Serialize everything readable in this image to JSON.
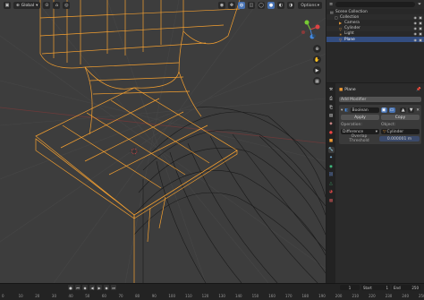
{
  "viewport": {
    "transform_mode": "Global",
    "options_label": "Options"
  },
  "outliner": {
    "items": [
      {
        "label": "Scene Collection",
        "indent": 0,
        "icon": "scene-collection-icon",
        "color": "#bbbbbb"
      },
      {
        "label": "Collection",
        "indent": 1,
        "icon": "collection-icon",
        "color": "#bbbbbb"
      },
      {
        "label": "Camera",
        "indent": 2,
        "icon": "camera-icon",
        "color": "#e59a3a"
      },
      {
        "label": "Cylinder",
        "indent": 2,
        "icon": "mesh-icon",
        "color": "#e59a3a"
      },
      {
        "label": "Light",
        "indent": 2,
        "icon": "light-icon",
        "color": "#e59a3a"
      },
      {
        "label": "Plane",
        "indent": 2,
        "icon": "mesh-icon",
        "color": "#e59a3a",
        "selected": true
      }
    ]
  },
  "properties": {
    "object_name": "Plane",
    "add_modifier_label": "Add Modifier",
    "modifier": {
      "name": "Boolean",
      "apply_label": "Apply",
      "copy_label": "Copy",
      "operation_label": "Operation:",
      "operation_value": "Difference",
      "object_label": "Object:",
      "object_value": "Cylinder",
      "overlap_label": "Overlap Threshold",
      "overlap_value": "0.000001 m"
    }
  },
  "timeline": {
    "current_frame": "1",
    "start_label": "Start",
    "start_value": "1",
    "end_label": "End",
    "end_value": "250",
    "ticks": [
      "0",
      "10",
      "20",
      "30",
      "40",
      "50",
      "60",
      "70",
      "80",
      "90",
      "100",
      "110",
      "120",
      "130",
      "140",
      "150",
      "160",
      "170",
      "180",
      "190",
      "200",
      "210",
      "220",
      "230",
      "240",
      "250"
    ]
  },
  "colors": {
    "selection": "#f5a030",
    "wire": "#1a1a1a",
    "grid": "#4a4a4a",
    "accent": "#4772b3"
  }
}
